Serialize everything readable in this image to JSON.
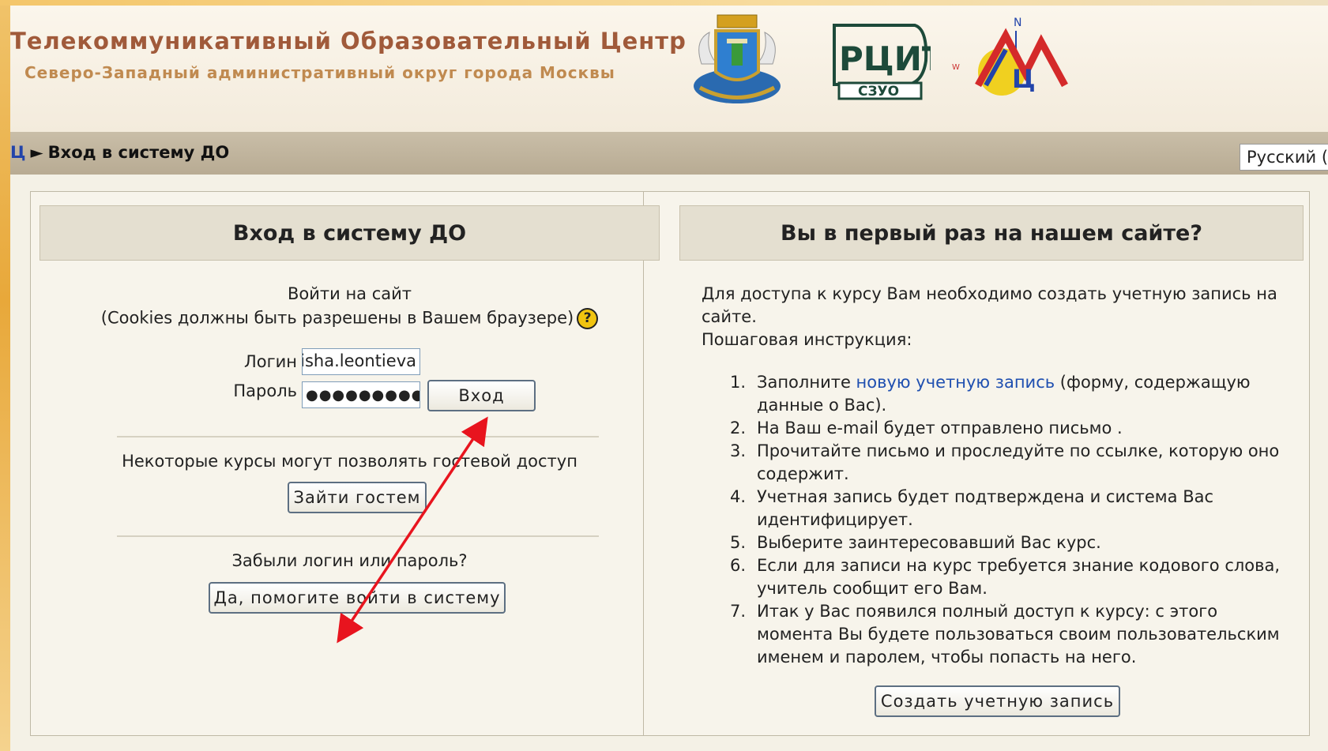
{
  "header": {
    "title": "Телекоммуникативный Образовательный Центр",
    "subtitle": "Северо-Западный административный округ города Москвы",
    "rcit_logo_text": "РЦИТ",
    "rcit_logo_subtext": "СЗУО",
    "mc_logo_text": "Ц",
    "mc_logo_compass": "N",
    "mc_logo_w": "W"
  },
  "nav": {
    "home_crumb": "Ц",
    "separator": "►",
    "current_crumb": "Вход в систему ДО",
    "language": "Русский (ru)"
  },
  "login_panel": {
    "heading": "Вход в систему ДО",
    "prompt": "Войти на сайт",
    "cookies_note": "(Cookies должны быть разрешены в Вашем браузере)",
    "help_icon_glyph": "?",
    "username_label": "Логин",
    "username_value": "misha.leontieva",
    "password_label": "Пароль",
    "password_value": "●●●●●●●●●●●",
    "login_button": "Вход",
    "guest_note": "Некоторые курсы могут позволять гостевой доступ",
    "guest_button": "Зайти гостем",
    "forgot_note": "Забыли логин или пароль?",
    "forgot_button": "Да, помогите войти в систему"
  },
  "signup_panel": {
    "heading": "Вы в первый раз на нашем сайте?",
    "intro": "Для доступа к курсу Вам необходимо создать учетную запись на сайте.",
    "steps_label": "Пошаговая инструкция:",
    "steps": [
      {
        "num": "1.",
        "before": "Заполните ",
        "link": "новую учетную запись",
        "after": " (форму, содержащую данные о Вас)."
      },
      {
        "num": "2.",
        "before": "На Ваш e-mail будет отправлено письмо .",
        "link": "",
        "after": ""
      },
      {
        "num": "3.",
        "before": "Прочитайте письмо и проследуйте по ссылке, которую оно содержит.",
        "link": "",
        "after": ""
      },
      {
        "num": "4.",
        "before": "Учетная запись будет подтверждена и система Вас идентифицирует.",
        "link": "",
        "after": ""
      },
      {
        "num": "5.",
        "before": "Выберите заинтересовавший Вас курс.",
        "link": "",
        "after": ""
      },
      {
        "num": "6.",
        "before": "Если для записи на курс требуется знание кодового слова, учитель сообщит его Вам.",
        "link": "",
        "after": ""
      },
      {
        "num": "7.",
        "before": "Итак у Вас появился полный доступ к курсу: с этого момента Вы будете пользоваться своим пользовательским именем и паролем, чтобы попасть на него.",
        "link": "",
        "after": ""
      }
    ],
    "create_button": "Создать учетную запись"
  },
  "colors": {
    "title": "#a05a3a",
    "subtitle": "#c08a50",
    "link": "#1f4fb0",
    "arrow": "#e8141e"
  }
}
